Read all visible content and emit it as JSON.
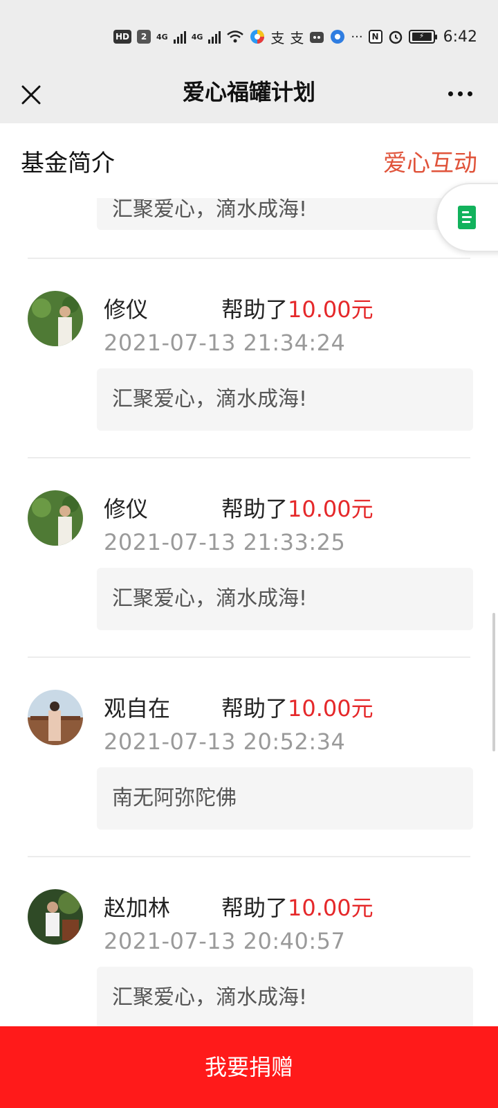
{
  "status_bar": {
    "hd": "HD",
    "sim": "2",
    "net1": "4G",
    "net2": "4G",
    "pay1": "支",
    "pay2": "支",
    "dots": "···",
    "nfc": "N",
    "time": "6:42"
  },
  "title_bar": {
    "title": "爱心福罐计划"
  },
  "tabs": {
    "left": "基金简介",
    "right": "爱心互动",
    "right_color": "#e0533a"
  },
  "partial_message": "汇聚爱心，滴水成海!",
  "records": [
    {
      "name": "修仪",
      "helped": "帮助了",
      "amount": "10.00元",
      "time": "2021-07-13 21:34:24",
      "message": "汇聚爱心，滴水成海!"
    },
    {
      "name": "修仪",
      "helped": "帮助了",
      "amount": "10.00元",
      "time": "2021-07-13 21:33:25",
      "message": "汇聚爱心，滴水成海!"
    },
    {
      "name": "观自在",
      "helped": "帮助了",
      "amount": "10.00元",
      "time": "2021-07-13 20:52:34",
      "message": "南无阿弥陀佛"
    },
    {
      "name": "赵加林",
      "helped": "帮助了",
      "amount": "10.00元",
      "time": "2021-07-13 20:40:57",
      "message": "汇聚爱心，滴水成海!"
    }
  ],
  "donate_button": "我要捐赠",
  "colors": {
    "accent_red": "#e5282a",
    "button_red": "#ff1a1a"
  }
}
